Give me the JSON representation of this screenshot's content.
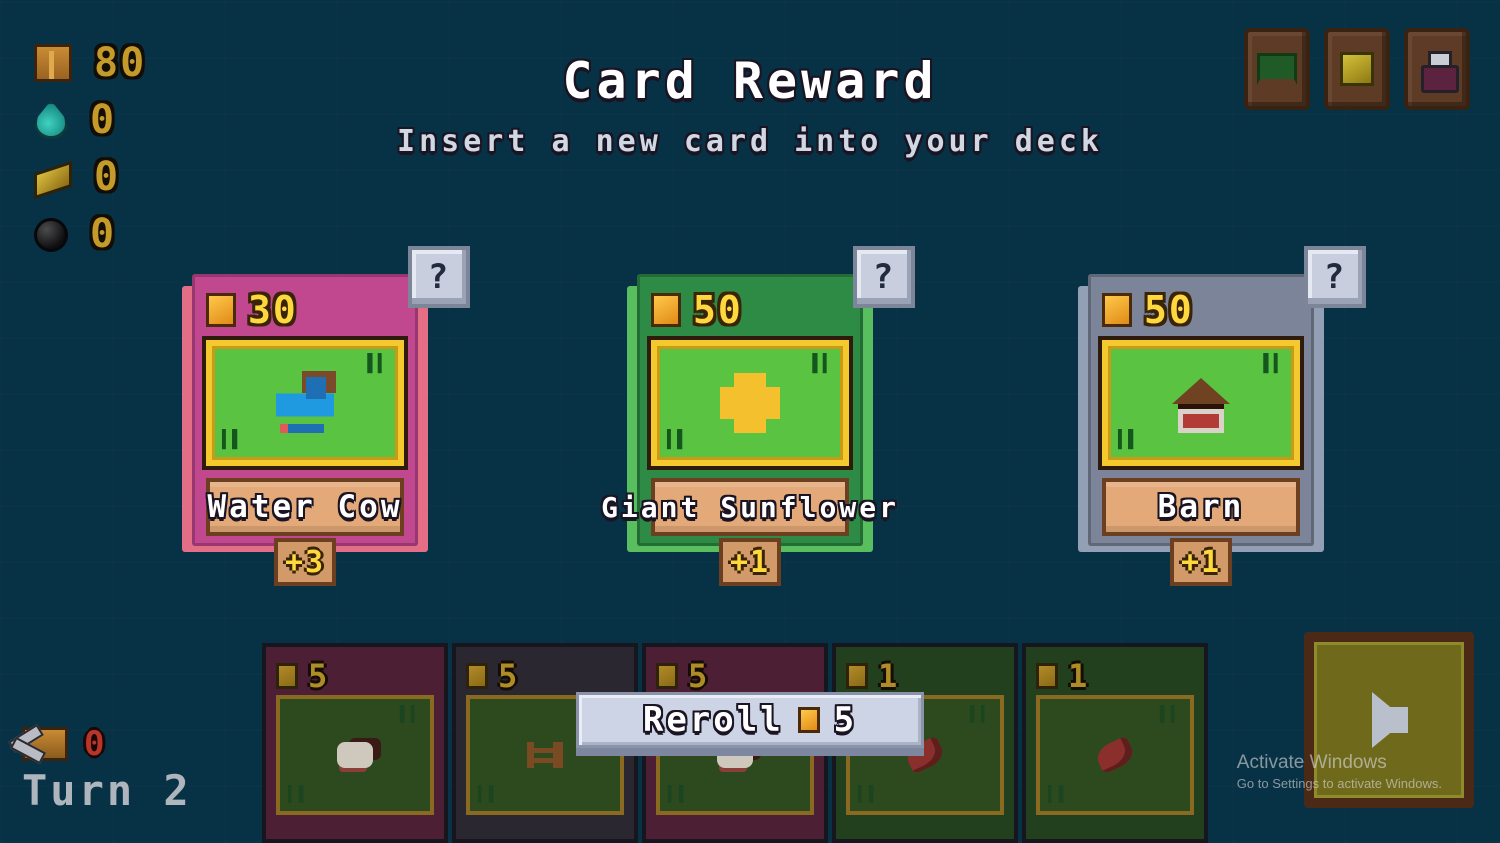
{
  "header": {
    "title": "Card Reward",
    "subtitle": "Insert a new card into your deck"
  },
  "resources": [
    {
      "icon": "wood-crate-icon",
      "value": "80"
    },
    {
      "icon": "water-drop-icon",
      "value": "0"
    },
    {
      "icon": "plank-icon",
      "value": "0"
    },
    {
      "icon": "bomb-icon",
      "value": "0"
    }
  ],
  "top_buttons": [
    {
      "name": "deck-button",
      "icon": "deck-icon"
    },
    {
      "name": "gold-button",
      "icon": "coin-icon"
    },
    {
      "name": "potion-button",
      "icon": "potion-icon"
    }
  ],
  "offers": [
    {
      "name": "Water Cow",
      "cost": "30",
      "bonus": "+3",
      "help": "?",
      "frame_color": "#c1478f",
      "frame_accent": "#f0728a",
      "sprite": "cow-sprite"
    },
    {
      "name": "Giant Sunflower",
      "cost": "50",
      "bonus": "+1",
      "help": "?",
      "frame_color": "#2e8b46",
      "frame_accent": "#5ec65f",
      "sprite": "sunflower-sprite"
    },
    {
      "name": "Barn",
      "cost": "50",
      "bonus": "+1",
      "help": "?",
      "frame_color": "#7b8499",
      "frame_accent": "#9aa5bb",
      "sprite": "barn-sprite"
    }
  ],
  "reroll": {
    "label": "Reroll",
    "cost": "5",
    "coin_icon": "coin-icon"
  },
  "hand": [
    {
      "cost": "5",
      "bg": "#4d1f34",
      "sprite": "sheep-sprite"
    },
    {
      "cost": "5",
      "bg": "#2a2730",
      "sprite": "fence-sprite"
    },
    {
      "cost": "5",
      "bg": "#4d1f34",
      "sprite": "sheep-sprite"
    },
    {
      "cost": "1",
      "bg": "#22401d",
      "sprite": "log-sprite"
    },
    {
      "cost": "1",
      "bg": "#22401d",
      "sprite": "log-sprite"
    }
  ],
  "turn": {
    "resource_icon": "tool-crate-icon",
    "resource_value": "0",
    "label": "Turn 2"
  },
  "end_turn": {
    "icon": "arrow-right-icon"
  },
  "watermark": {
    "line1": "Activate Windows",
    "line2": "Go to Settings to activate Windows."
  },
  "colors": {
    "background": "#073145",
    "gold": "#ffd83d",
    "banner": "#e3a978",
    "art_green": "#5bc342"
  }
}
